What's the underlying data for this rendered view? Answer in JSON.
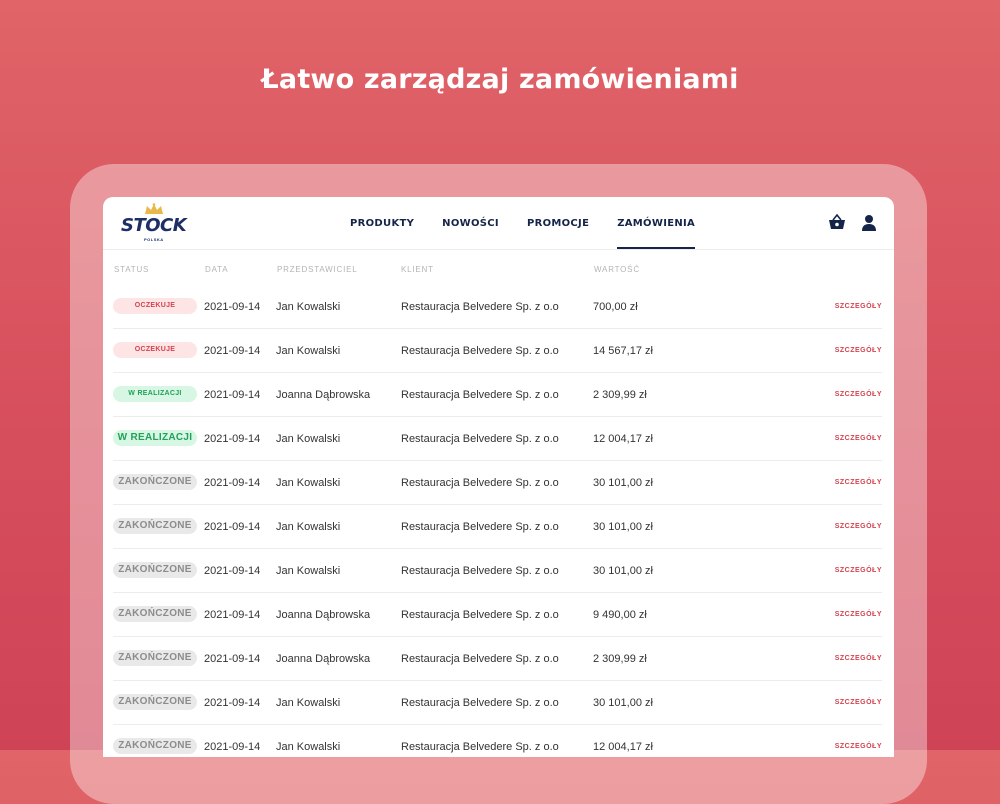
{
  "headline": "Łatwo zarządzaj zamówieniami",
  "brand": {
    "name": "STOCK",
    "sub": "POLSKA"
  },
  "nav": [
    {
      "label": "PRODUKTY",
      "active": false
    },
    {
      "label": "NOWOŚCI",
      "active": false
    },
    {
      "label": "PROMOCJE",
      "active": false
    },
    {
      "label": "ZAMÓWIENIA",
      "active": true
    }
  ],
  "icons": {
    "cart": "basket-icon",
    "user": "user-icon"
  },
  "colors": {
    "accent": "#d4424f",
    "navy": "#152449",
    "success": "#21a15a"
  },
  "table": {
    "headers": {
      "status": "STATUS",
      "date": "DATA",
      "rep": "PRZEDSTAWICIEL",
      "client": "KLIENT",
      "value": "WARTOŚĆ"
    },
    "details_label": "SZCZEGÓŁY",
    "rows": [
      {
        "status": "OCZEKUJE",
        "date": "2021-09-14",
        "rep": "Jan Kowalski",
        "client": "Restauracja Belvedere Sp. z o.o",
        "value": "700,00 zł"
      },
      {
        "status": "OCZEKUJE",
        "date": "2021-09-14",
        "rep": "Jan Kowalski",
        "client": "Restauracja Belvedere Sp. z o.o",
        "value": "14 567,17 zł"
      },
      {
        "status": "W REALIZACJI",
        "date": "2021-09-14",
        "rep": "Joanna Dąbrowska",
        "client": "Restauracja Belvedere Sp. z o.o",
        "value": "2 309,99 zł"
      },
      {
        "status": "W REALIZACJI",
        "date": "2021-09-14",
        "rep": "Jan Kowalski",
        "client": "Restauracja Belvedere Sp. z o.o",
        "value": "12 004,17 zł"
      },
      {
        "status": "ZAKOŃCZONE",
        "date": "2021-09-14",
        "rep": "Jan Kowalski",
        "client": "Restauracja Belvedere Sp. z o.o",
        "value": "30 101,00 zł"
      },
      {
        "status": "ZAKOŃCZONE",
        "date": "2021-09-14",
        "rep": "Jan Kowalski",
        "client": "Restauracja Belvedere Sp. z o.o",
        "value": "30 101,00 zł"
      },
      {
        "status": "ZAKOŃCZONE",
        "date": "2021-09-14",
        "rep": "Jan Kowalski",
        "client": "Restauracja Belvedere Sp. z o.o",
        "value": "30 101,00 zł"
      },
      {
        "status": "ZAKOŃCZONE",
        "date": "2021-09-14",
        "rep": "Joanna Dąbrowska",
        "client": "Restauracja Belvedere Sp. z o.o",
        "value": "9 490,00 zł"
      },
      {
        "status": "ZAKOŃCZONE",
        "date": "2021-09-14",
        "rep": "Joanna Dąbrowska",
        "client": "Restauracja Belvedere Sp. z o.o",
        "value": "2 309,99 zł"
      },
      {
        "status": "ZAKOŃCZONE",
        "date": "2021-09-14",
        "rep": "Jan Kowalski",
        "client": "Restauracja Belvedere Sp. z o.o",
        "value": "30 101,00 zł"
      },
      {
        "status": "ZAKOŃCZONE",
        "date": "2021-09-14",
        "rep": "Jan Kowalski",
        "client": "Restauracja Belvedere Sp. z o.o",
        "value": "12 004,17 zł"
      }
    ]
  }
}
